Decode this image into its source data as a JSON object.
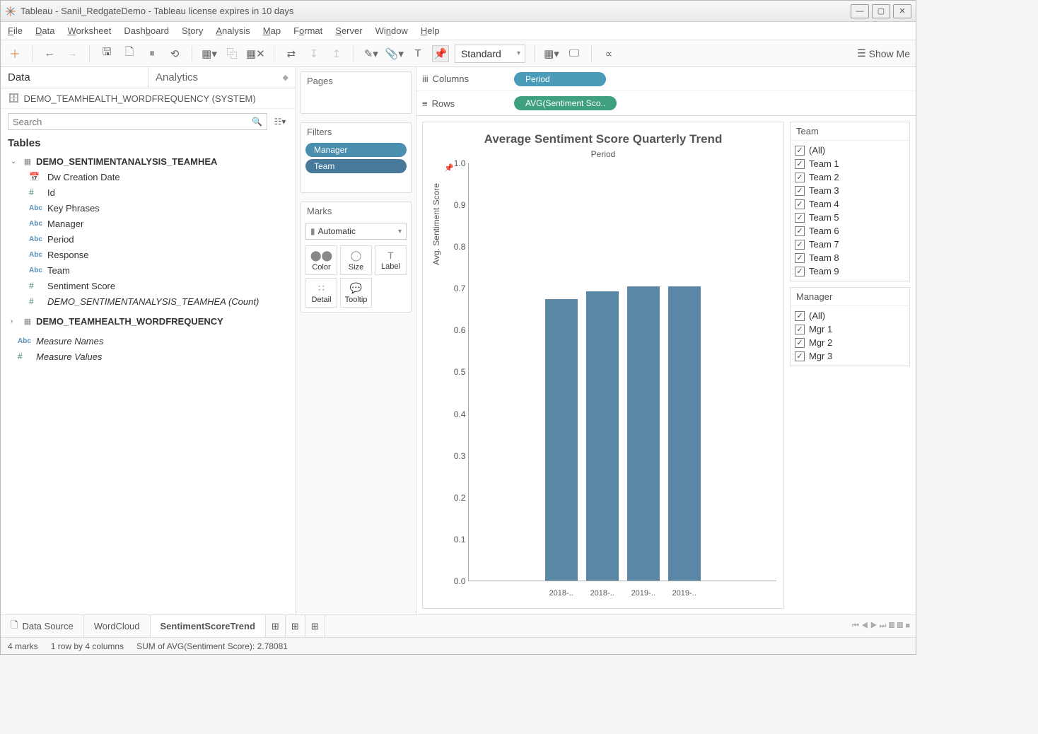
{
  "window": {
    "title": "Tableau - Sanil_RedgateDemo - Tableau license expires in 10 days"
  },
  "menu": [
    "File",
    "Data",
    "Worksheet",
    "Dashboard",
    "Story",
    "Analysis",
    "Map",
    "Format",
    "Server",
    "Window",
    "Help"
  ],
  "toolbar": {
    "fit": "Standard",
    "showme": "Show Me"
  },
  "left": {
    "tab_data": "Data",
    "tab_analytics": "Analytics",
    "connection": "DEMO_TEAMHEALTH_WORDFREQUENCY (SYSTEM)",
    "search_placeholder": "Search",
    "tables_header": "Tables",
    "table1": "DEMO_SENTIMENTANALYSIS_TEAMHEA",
    "fields": {
      "dw": "Dw Creation Date",
      "id": "Id",
      "kp": "Key Phrases",
      "mgr": "Manager",
      "period": "Period",
      "resp": "Response",
      "team": "Team",
      "score": "Sentiment Score",
      "count": "DEMO_SENTIMENTANALYSIS_TEAMHEA (Count)"
    },
    "table2": "DEMO_TEAMHEALTH_WORDFREQUENCY",
    "mn": "Measure Names",
    "mv": "Measure Values"
  },
  "mid": {
    "pages": "Pages",
    "filters": "Filters",
    "marks": "Marks",
    "filter_pills": [
      "Manager",
      "Team"
    ],
    "mark_mode": "Automatic",
    "mark_btns": [
      "Color",
      "Size",
      "Label",
      "Detail",
      "Tooltip"
    ]
  },
  "shelves": {
    "columns_label": "Columns",
    "rows_label": "Rows",
    "columns_pill": "Period",
    "rows_pill": "AVG(Sentiment Sco.."
  },
  "viz": {
    "title": "Average Sentiment Score Quarterly Trend",
    "subtitle": "Period",
    "y_title": "Avg. Sentiment Score"
  },
  "chart_data": {
    "type": "bar",
    "categories": [
      "2018-..",
      "2018-..",
      "2019-..",
      "2019-.."
    ],
    "values": [
      0.675,
      0.694,
      0.705,
      0.705
    ],
    "title": "Average Sentiment Score Quarterly Trend",
    "xlabel": "Period",
    "ylabel": "Avg. Sentiment Score",
    "ylim": [
      0.0,
      1.0
    ],
    "y_ticks": [
      "1.0",
      "0.9",
      "0.8",
      "0.7",
      "0.6",
      "0.5",
      "0.4",
      "0.3",
      "0.2",
      "0.1",
      "0.0"
    ]
  },
  "filters_right": {
    "team_title": "Team",
    "team_items": [
      "(All)",
      "Team 1",
      "Team 2",
      "Team 3",
      "Team 4",
      "Team 5",
      "Team 6",
      "Team 7",
      "Team 8",
      "Team 9"
    ],
    "mgr_title": "Manager",
    "mgr_items": [
      "(All)",
      "Mgr 1",
      "Mgr 2",
      "Mgr 3"
    ]
  },
  "bottom": {
    "datasource": "Data Source",
    "tabs": [
      "WordCloud",
      "SentimentScoreTrend"
    ]
  },
  "status": {
    "marks": "4 marks",
    "dims": "1 row by 4 columns",
    "sum": "SUM of AVG(Sentiment Score): 2.78081"
  }
}
